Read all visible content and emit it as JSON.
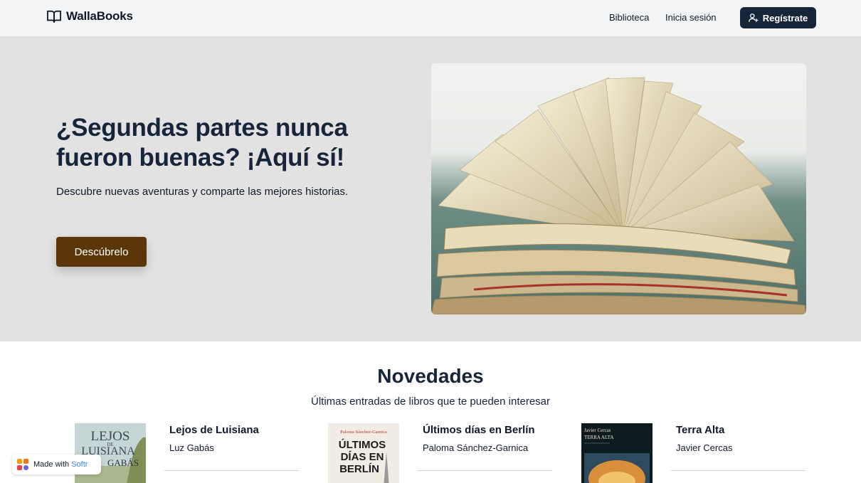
{
  "header": {
    "brand": "WallaBooks",
    "nav": [
      {
        "label": "Biblioteca"
      },
      {
        "label": "Inicia sesión"
      }
    ],
    "signup_label": "Regístrate"
  },
  "hero": {
    "title": "¿Segundas partes nunca fueron buenas? ¡Aquí sí!",
    "subtitle": "Descubre nuevas aventuras y comparte las mejores historias.",
    "cta_label": "Descúbrelo"
  },
  "novedades": {
    "title": "Novedades",
    "subtitle": "Últimas entradas de libros que te pueden interesar",
    "books": [
      {
        "title": "Lejos de Luisiana",
        "author": "Luz Gabás",
        "cover_lines": [
          "LEJOS",
          "DE",
          "LUISIANA",
          "GABÁS"
        ]
      },
      {
        "title": "Últimos días en Berlín",
        "author": "Paloma Sánchez-Garnica",
        "cover_lines": [
          "Paloma Sánchez-Garnica",
          "ÚLTIMOS",
          "DÍAS EN",
          "BERLÍN"
        ]
      },
      {
        "title": "Terra Alta",
        "author": "Javier Cercas",
        "cover_lines": [
          "Javier Cercas",
          "TERRA ALTA"
        ]
      }
    ]
  },
  "badge": {
    "text": "Made with",
    "brand": "Softr"
  },
  "colors": {
    "header_bg": "#f3f4f6",
    "hero_bg": "#e2e2e2",
    "primary_dark": "#17253a",
    "cta_brown": "#5a3608"
  },
  "icons": {
    "brand": "open-book-icon",
    "signup": "user-plus-icon",
    "badge": "softr-logo"
  }
}
